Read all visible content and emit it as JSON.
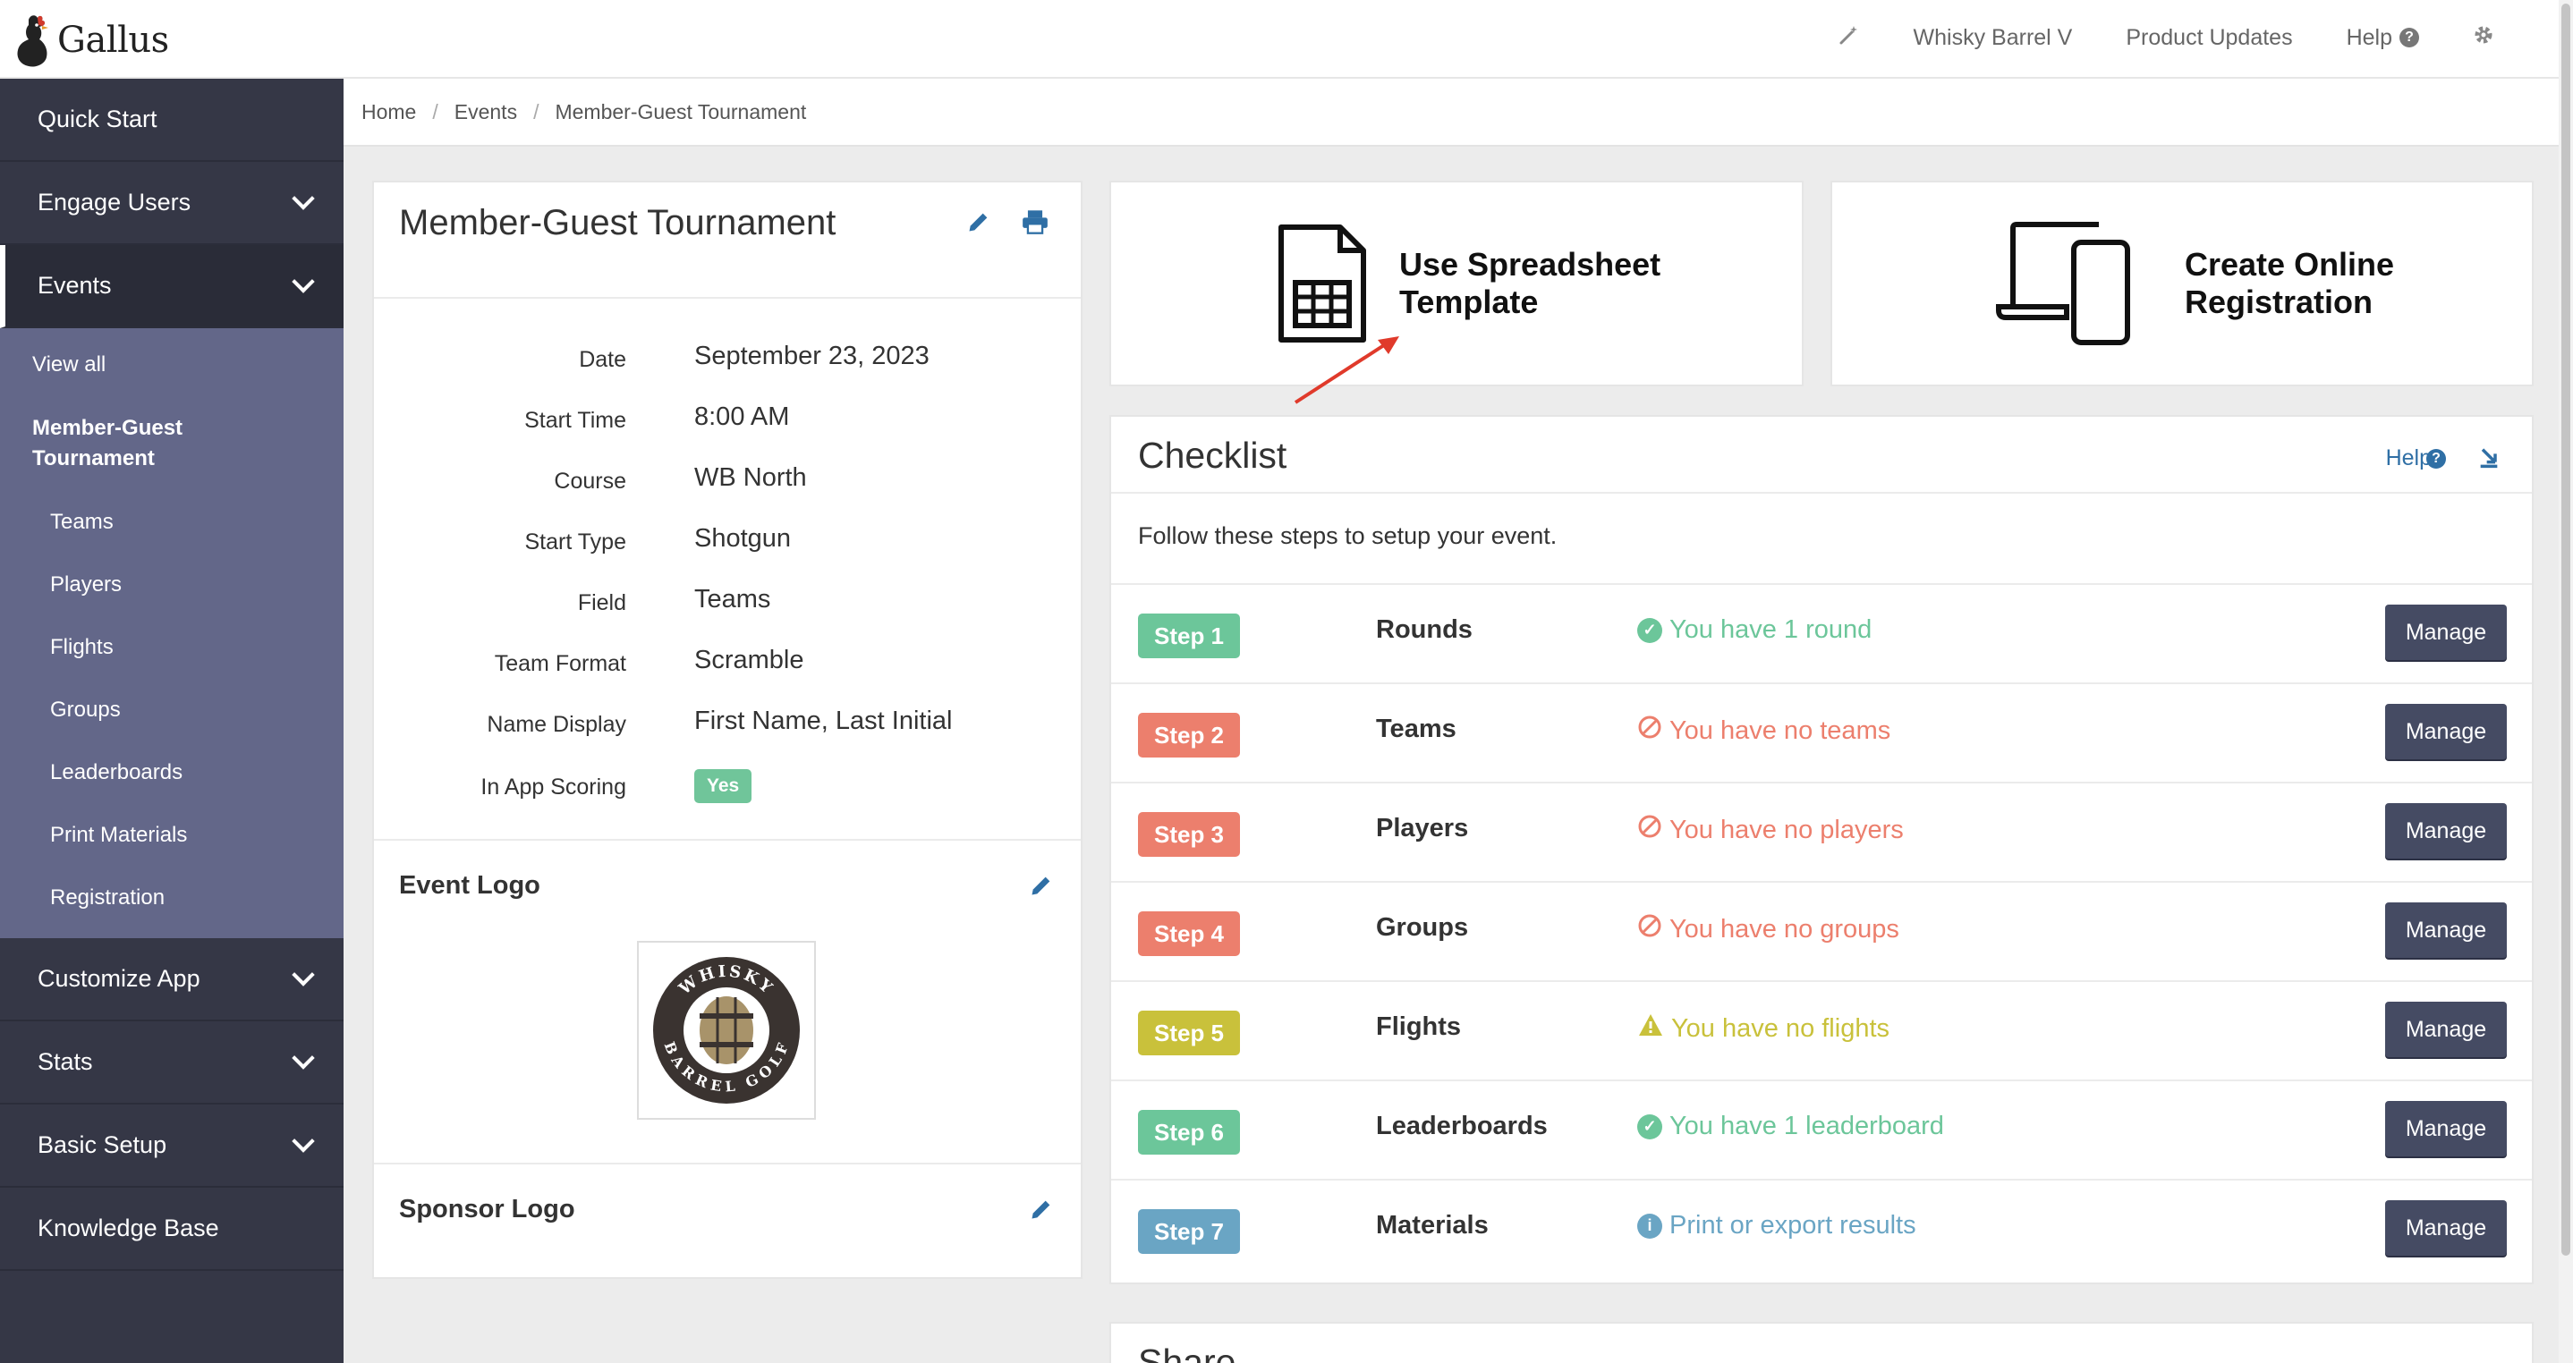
{
  "app": {
    "name": "Gallus"
  },
  "topnav": {
    "org": "Whisky Barrel V",
    "updates": "Product Updates",
    "help": "Help"
  },
  "sidebar": {
    "quick_start": "Quick Start",
    "engage_users": "Engage Users",
    "events": "Events",
    "events_sub": {
      "view_all": "View all",
      "current_event": "Member-Guest Tournament",
      "teams": "Teams",
      "players": "Players",
      "flights": "Flights",
      "groups": "Groups",
      "leaderboards": "Leaderboards",
      "print_materials": "Print Materials",
      "registration": "Registration"
    },
    "customize_app": "Customize App",
    "stats": "Stats",
    "basic_setup": "Basic Setup",
    "knowledge_base": "Knowledge Base"
  },
  "breadcrumb": {
    "home": "Home",
    "events": "Events",
    "current": "Member-Guest Tournament"
  },
  "event": {
    "title": "Member-Guest Tournament",
    "details": [
      {
        "label": "Date",
        "value": "September 23, 2023"
      },
      {
        "label": "Start Time",
        "value": "8:00 AM"
      },
      {
        "label": "Course",
        "value": "WB North"
      },
      {
        "label": "Start Type",
        "value": "Shotgun"
      },
      {
        "label": "Field",
        "value": "Teams"
      },
      {
        "label": "Team Format",
        "value": "Scramble"
      },
      {
        "label": "Name Display",
        "value": "First Name, Last Initial"
      },
      {
        "label": "In App Scoring",
        "value": "Yes"
      }
    ],
    "event_logo_title": "Event Logo",
    "logo_text_top": "WHISKY",
    "logo_text_bottom": "BARREL GOLF",
    "sponsor_logo_title": "Sponsor Logo"
  },
  "actions": {
    "spreadsheet": "Use Spreadsheet Template",
    "spreadsheet_line1": "Use Spreadsheet",
    "spreadsheet_line2": "Template",
    "online": "Create Online Registration",
    "online_line1": "Create Online",
    "online_line2": "Registration"
  },
  "checklist": {
    "title": "Checklist",
    "help": "Help",
    "intro": "Follow these steps to setup your event.",
    "manage_label": "Manage",
    "steps": [
      {
        "badge": "Step 1",
        "name": "Rounds",
        "status": "You have 1 round",
        "state": "ok",
        "color": "#6cc69a"
      },
      {
        "badge": "Step 2",
        "name": "Teams",
        "status": "You have no teams",
        "state": "error",
        "color": "#ec7f6d"
      },
      {
        "badge": "Step 3",
        "name": "Players",
        "status": "You have no players",
        "state": "error",
        "color": "#ec7f6d"
      },
      {
        "badge": "Step 4",
        "name": "Groups",
        "status": "You have no groups",
        "state": "error",
        "color": "#ec7f6d"
      },
      {
        "badge": "Step 5",
        "name": "Flights",
        "status": "You have no flights",
        "state": "warning",
        "color": "#c9c13b"
      },
      {
        "badge": "Step 6",
        "name": "Leaderboards",
        "status": "You have 1 leaderboard",
        "state": "ok",
        "color": "#6cc69a"
      },
      {
        "badge": "Step 7",
        "name": "Materials",
        "status": "Print or export results",
        "state": "info",
        "color": "#6aa5c4"
      }
    ]
  },
  "share": {
    "title": "Share"
  },
  "colors": {
    "sidebar_bg": "#353746",
    "submenu_bg": "#636789",
    "link_blue": "#2f6fa5",
    "button_dark": "#454b63",
    "ok_green": "#6cc69a",
    "error_red": "#ec7f6d",
    "warning_yellow": "#c9c13b",
    "info_blue": "#6aa5c4"
  }
}
